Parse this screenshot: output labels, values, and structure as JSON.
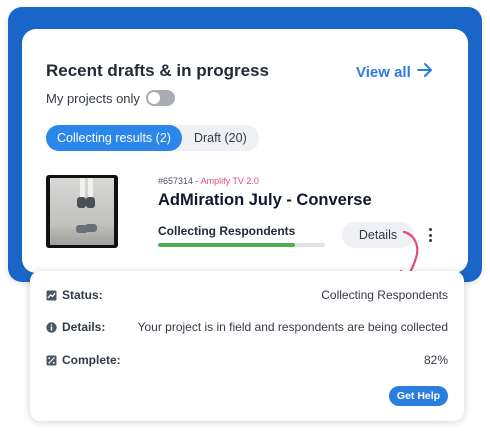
{
  "card": {
    "title": "Recent drafts & in progress",
    "view_all_label": "View all"
  },
  "toggle": {
    "label": "My projects only",
    "checked": false
  },
  "tabs": [
    {
      "label": "Collecting results (2)",
      "active": true
    },
    {
      "label": "Draft (20)",
      "active": false
    }
  ],
  "project": {
    "id": "#657314",
    "separator": " - ",
    "product": "Amplify TV 2.0",
    "title": "AdMiration July - Converse",
    "status": "Collecting Respondents",
    "progress_fraction": 0.82,
    "details_label": "Details"
  },
  "popup": {
    "status_label": "Status:",
    "status_value": "Collecting Respondents",
    "details_label": "Details:",
    "details_value": "Your project is in field and respondents are being collected",
    "complete_label": "Complete:",
    "complete_value": "82%",
    "help_label": "Get Help"
  },
  "colors": {
    "brand_blue": "#1966c8",
    "accent_blue": "#2b86ec",
    "progress_green": "#4cae4f",
    "annotation_pink": "#e54a8a"
  },
  "icons": [
    "arrow-right-icon",
    "kebab-menu-icon",
    "status-icon",
    "info-icon",
    "complete-icon",
    "curved-arrow-icon"
  ]
}
